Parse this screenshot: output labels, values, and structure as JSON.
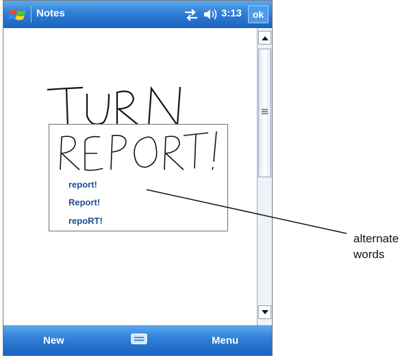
{
  "titlebar": {
    "app_title": "Notes",
    "clock": "3:13",
    "ok_label": "ok",
    "start_icon": "windows-flag-icon",
    "connect_icon": "connectivity-arrows-icon",
    "volume_icon": "speaker-icon"
  },
  "alternates": {
    "options": [
      "report!",
      "Report!",
      "repoRT!"
    ]
  },
  "menubar": {
    "left_label": "New",
    "right_label": "Menu",
    "center_icon": "keyboard-icon"
  },
  "callout": {
    "line1": "alternate",
    "line2": "words"
  },
  "colors": {
    "bar_blue": "#2f7fd6",
    "option_text": "#1f4e92"
  }
}
